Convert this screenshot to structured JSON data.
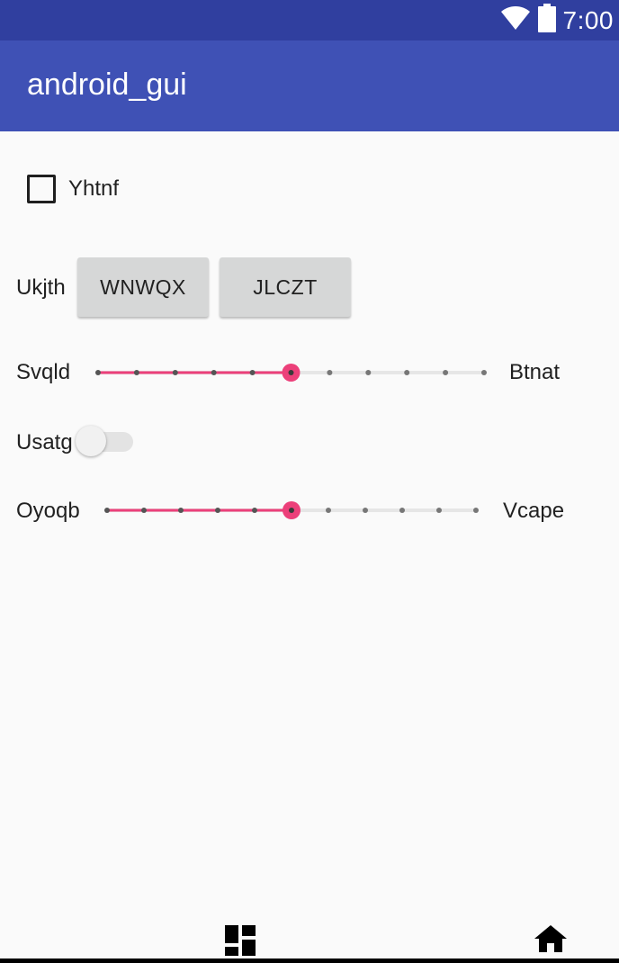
{
  "status_bar": {
    "time": "7:00",
    "icons": [
      "wifi-icon",
      "battery-icon"
    ]
  },
  "app_bar": {
    "title": "android_gui"
  },
  "checkbox": {
    "label": "Yhtnf",
    "checked": false
  },
  "button_row": {
    "label": "Ukjth",
    "buttons": [
      "WNWQX",
      "JLCZT"
    ]
  },
  "slider1": {
    "left_label": "Svqld",
    "right_label": "Btnat",
    "steps": 10,
    "value": 5
  },
  "switch_row": {
    "label": "Usatg",
    "on": false
  },
  "slider2": {
    "left_label": "Oyoqb",
    "right_label": "Vcape",
    "steps": 10,
    "value": 5
  },
  "nav_bar": {
    "icons": [
      "dashboard-icon",
      "home-icon"
    ]
  },
  "colors": {
    "status_bar": "#303f9f",
    "app_bar": "#3f51b5",
    "accent": "#ec407a",
    "background": "#fafafa"
  }
}
